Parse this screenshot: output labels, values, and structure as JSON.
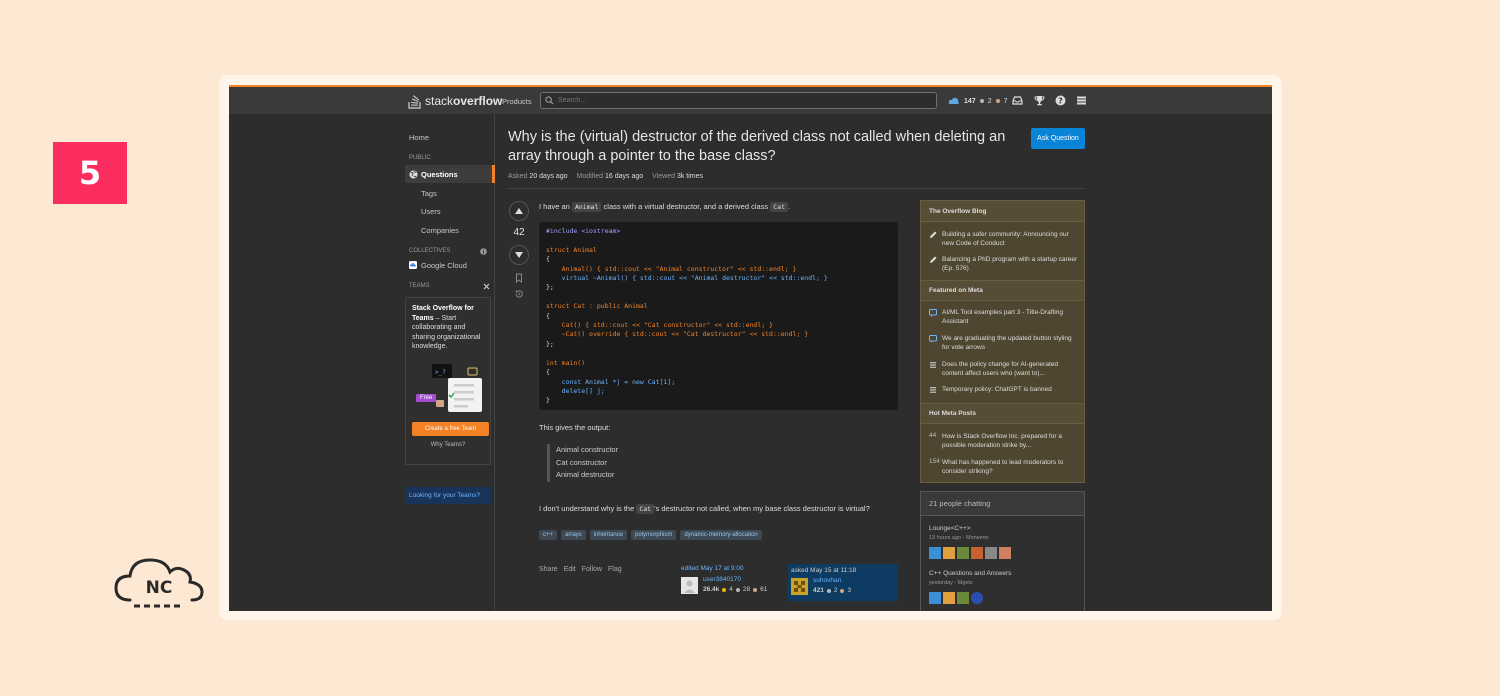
{
  "badge": {
    "number": "5"
  },
  "logo_nc": {
    "text": "NC"
  },
  "topbar": {
    "logo_word1": "stack",
    "logo_word2": "overflow",
    "products": "Products",
    "search_placeholder": "Search...",
    "reputation": "147",
    "silver_count": "2",
    "bronze_count": "7",
    "icons": [
      "inbox-icon",
      "achievements-icon",
      "help-icon",
      "site-switcher-icon"
    ]
  },
  "sidebar": {
    "home": "Home",
    "public": "PUBLIC",
    "questions": "Questions",
    "tags": "Tags",
    "users": "Users",
    "companies": "Companies",
    "collectives": "COLLECTIVES",
    "google_cloud": "Google Cloud",
    "teams": "TEAMS",
    "teams_title": "Stack Overflow for Teams",
    "teams_desc": " – Start collaborating and sharing organizational knowledge.",
    "free_label": "Free",
    "create_team": "Create a free Team",
    "why_teams": "Why Teams?",
    "looking_teams": "Looking for your Teams?"
  },
  "question": {
    "title": "Why is the (virtual) destructor of the derived class not called when deleting an array through a pointer to the base class?",
    "ask_button": "Ask Question",
    "asked_label": "Asked",
    "asked_value": "20 days ago",
    "modified_label": "Modified",
    "modified_value": "16 days ago",
    "viewed_label": "Viewed",
    "viewed_value": "3k times",
    "votes": "42",
    "intro_1": "I have an ",
    "intro_code1": "Animal",
    "intro_2": " class with a virtual destructor, and a derived class ",
    "intro_code2": "Cat",
    "intro_3": ".",
    "output_intro": "This gives the output:",
    "output_lines": [
      "Animal constructor",
      "Cat constructor",
      "Animal destructor"
    ],
    "closing_1": "I don't understand why is the ",
    "closing_code": "Cat",
    "closing_2": "'s destructor not called, when my base class destructor is virtual?",
    "tags": [
      "c++",
      "arrays",
      "inheritance",
      "polymorphism",
      "dynamic-memory-allocation"
    ],
    "actions": [
      "Share",
      "Edit",
      "Follow",
      "Flag"
    ],
    "edited_label": "edited May 17 at 9:00",
    "editor_name": "user3840170",
    "editor_rep": "26.4k",
    "editor_gold": "4",
    "editor_silver": "28",
    "editor_bronze": "61",
    "asked_card_label": "asked May 15 at 11:18",
    "asker_name": "suhovhan",
    "asker_rep": "421",
    "asker_silver": "2",
    "asker_bronze": "3"
  },
  "code": [
    "#include <iostream>",
    "",
    "struct Animal",
    "{",
    "    Animal() { std::cout << \"Animal constructor\" << std::endl; }",
    "    virtual ~Animal() { std::cout << \"Animal destructor\" << std::endl; }",
    "};",
    "",
    "struct Cat : public Animal",
    "{",
    "    Cat() { std::cout << \"Cat constructor\" << std::endl; }",
    "    ~Cat() override { std::cout << \"Cat destructor\" << std::endl; }",
    "};",
    "",
    "int main()",
    "{",
    "    const Animal *j = new Cat[1];",
    "    delete[] j;",
    "}"
  ],
  "right": {
    "blog_title": "The Overflow Blog",
    "blog_items": [
      "Building a safer community: Announcing our new Code of Conduct",
      "Balancing a PhD program with a startup career (Ep. 576)"
    ],
    "meta_title": "Featured on Meta",
    "meta_items": [
      "AI/ML Tool examples part 3 - Title-Drafting Assistant",
      "We are graduating the updated button styling for vote arrows",
      "Does the policy change for AI-generated content affect users who (want to)...",
      "Temporary policy: ChatGPT is banned"
    ],
    "hot_title": "Hot Meta Posts",
    "hot_items": [
      {
        "count": "44",
        "text": "How is Stack Overflow Inc. prepared for a possible moderation strike by..."
      },
      {
        "count": "154",
        "text": "What has happened to lead moderators to consider striking?"
      }
    ],
    "chat_head": "21 people chatting",
    "room1": "Lounge<C++>",
    "room1_sub": "13 hours ago - Morwenn",
    "room2": "C++ Questions and Answers",
    "room2_sub": "yesterday - Mgetz"
  },
  "colors": {
    "accent": "#f48225",
    "badge": "#fb2c5e",
    "link": "#0a84d6"
  }
}
